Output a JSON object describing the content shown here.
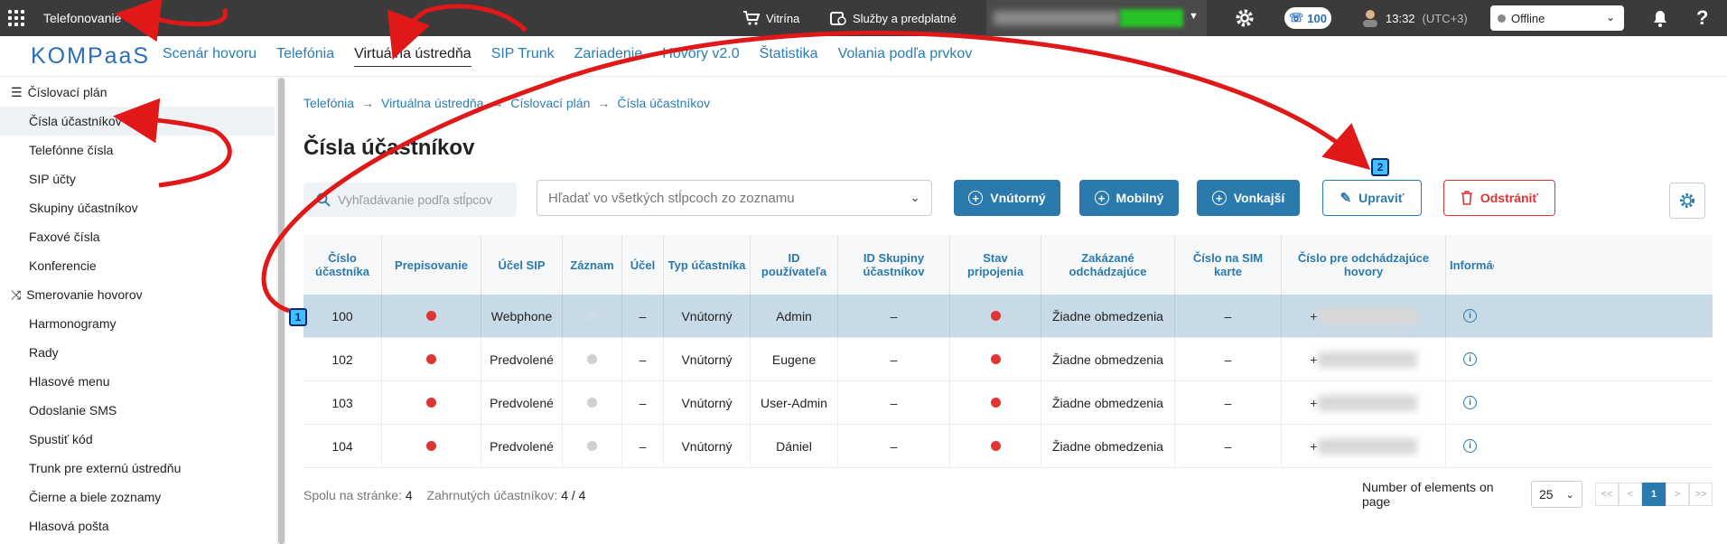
{
  "topbar": {
    "app_title": "Telefonovanie",
    "vitrina": "Vitrína",
    "services": "Služby a predplatné",
    "phone_count": "100",
    "time": "13:32",
    "timezone": "(UTC+3)",
    "status": "Offline"
  },
  "navbar": {
    "logo": "KOMPaaS",
    "items": [
      "Scenár hovoru",
      "Telefónia",
      "Virtuálna ústredňa",
      "SIP Trunk",
      "Zariadenie",
      "Hovory v2.0",
      "Štatistika",
      "Volania podľa prvkov"
    ]
  },
  "sidebar": {
    "group1": "Číslovací plán",
    "group1_items": [
      "Čísla účastníkov",
      "Telefónne čísla",
      "SIP účty",
      "Skupiny účastníkov",
      "Faxové čísla",
      "Konferencie"
    ],
    "group2": "Smerovanie hovorov",
    "group2_items": [
      "Harmonogramy",
      "Rady",
      "Hlasové menu",
      "Odoslanie SMS",
      "Spustiť kód",
      "Trunk pre externú ústredňu",
      "Čierne a biele zoznamy",
      "Hlasová pošta"
    ]
  },
  "breadcrumb": [
    "Telefónia",
    "Virtuálna ústredňa",
    "Číslovací plán",
    "Čísla účastníkov"
  ],
  "page_title": "Čísla účastníkov",
  "toolbar": {
    "filter_placeholder": "Vyhľadávanie podľa stĺpcov",
    "search_placeholder": "Hľadať vo všetkých stĺpcoch zo zoznamu",
    "btn_internal": "Vnútorný",
    "btn_mobile": "Mobilný",
    "btn_external": "Vonkajší",
    "btn_edit": "Upraviť",
    "btn_delete": "Odstrániť"
  },
  "table": {
    "headers": [
      "Číslo účastníka",
      "Prepisovanie",
      "Účel SIP",
      "Záznam",
      "Účel",
      "Typ účastníka",
      "ID používateľa",
      "ID Skupiny účastníkov",
      "Stav pripojenia",
      "Zakázané odchádzajúce",
      "Číslo na SIM karte",
      "Číslo pre odchádzajúce hovory",
      "Informácie"
    ],
    "rows": [
      {
        "number": "100",
        "sip": "Webphone",
        "purpose": "–",
        "type": "Vnútorný",
        "user": "Admin",
        "group": "–",
        "restriction": "Žiadne obmedzenia",
        "sim": "–",
        "outgoing": "+",
        "selected": true
      },
      {
        "number": "102",
        "sip": "Predvolené",
        "purpose": "–",
        "type": "Vnútorný",
        "user": "Eugene",
        "group": "–",
        "restriction": "Žiadne obmedzenia",
        "sim": "–",
        "outgoing": "+",
        "selected": false
      },
      {
        "number": "103",
        "sip": "Predvolené",
        "purpose": "–",
        "type": "Vnútorný",
        "user": "User-Admin",
        "group": "–",
        "restriction": "Žiadne obmedzenia",
        "sim": "–",
        "outgoing": "+",
        "selected": false
      },
      {
        "number": "104",
        "sip": "Predvolené",
        "purpose": "–",
        "type": "Vnútorný",
        "user": "Dániel",
        "group": "–",
        "restriction": "Žiadne obmedzenia",
        "sim": "–",
        "outgoing": "+",
        "selected": false
      }
    ]
  },
  "footer": {
    "per_page_label": "Spolu na stránke:",
    "per_page_value": "4",
    "included_label": "Zahrnutých účastníkov:",
    "included_value": "4 / 4",
    "page_size_label": "Number of elements on page",
    "page_size": "25",
    "current_page": "1",
    "pager": [
      "<<",
      "<",
      "1",
      ">",
      ">>"
    ]
  },
  "markers": [
    "1",
    "2"
  ],
  "colors": {
    "accent": "#2a7aad",
    "delete": "#e03434",
    "annotation": "#e01818"
  }
}
